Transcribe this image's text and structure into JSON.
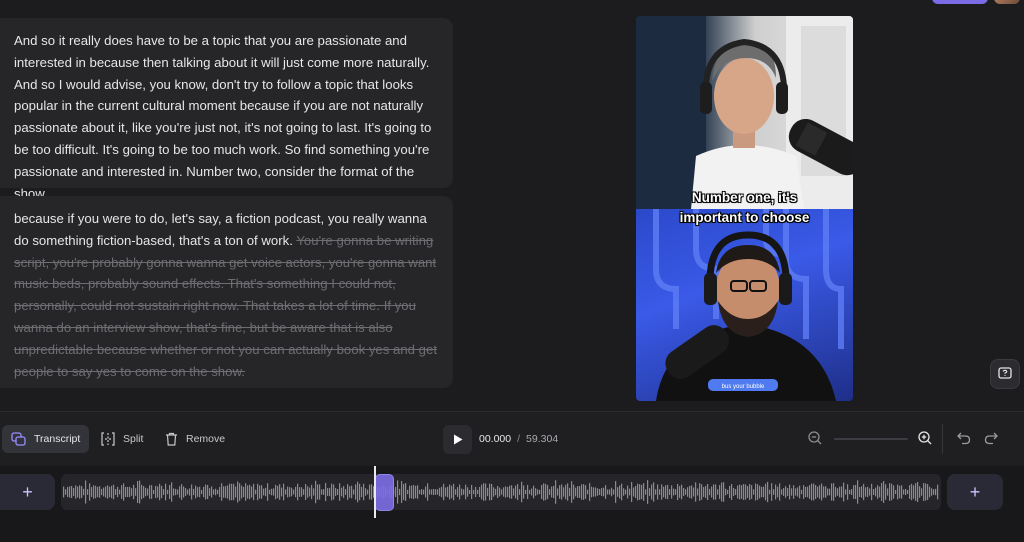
{
  "transcript": {
    "block1": {
      "text": "And so it really does have to be a topic that you are passionate and interested in because then talking about it will just come more naturally. And so I would advise, you know, don't try to follow a topic that looks popular in the current cultural moment because if you are not naturally passionate about it, like you're just not, it's not going to last. It's going to be too difficult. It's going to be too much work. So find something you're passionate and interested in. Number two, consider the format of the show."
    },
    "block2": {
      "active_text": "because if you were to do, let's say, a fiction podcast, you really wanna do something fiction-based, that's a ton of work. ",
      "removed_text": "You're gonna be writing script, you're probably gonna wanna get voice actors, you're gonna want music beds, probably sound effects. That's something I could not, personally, could not sustain right now. That takes a lot of time. If you wanna do an interview show, that's fine, but be aware that is also unpredictable because whether or not you can actually book yes and get people to say yes to come on the show."
    }
  },
  "video": {
    "caption_line1": "Number one, it's",
    "caption_line2": "important to choose",
    "shirt_text": "bus your bubble"
  },
  "toolbar": {
    "transcript_label": "Transcript",
    "split_label": "Split",
    "remove_label": "Remove",
    "current_time": "00.000",
    "separator": "/",
    "total_time": "59.304"
  },
  "timeline": {
    "add_left": "+",
    "add_right": "+",
    "playhead_fraction": 0.355
  },
  "colors": {
    "accent": "#7c6ee6",
    "background": "#1c1c1f",
    "card": "#262629",
    "struck_text": "#6d6d72"
  },
  "icons": {
    "help": "help-chat-icon",
    "play": "play-icon",
    "transcript": "transcript-icon",
    "split": "split-icon",
    "remove": "trash-icon",
    "zoom_out": "zoom-out-icon",
    "zoom_in": "zoom-in-icon",
    "undo": "undo-icon",
    "redo": "redo-icon"
  }
}
